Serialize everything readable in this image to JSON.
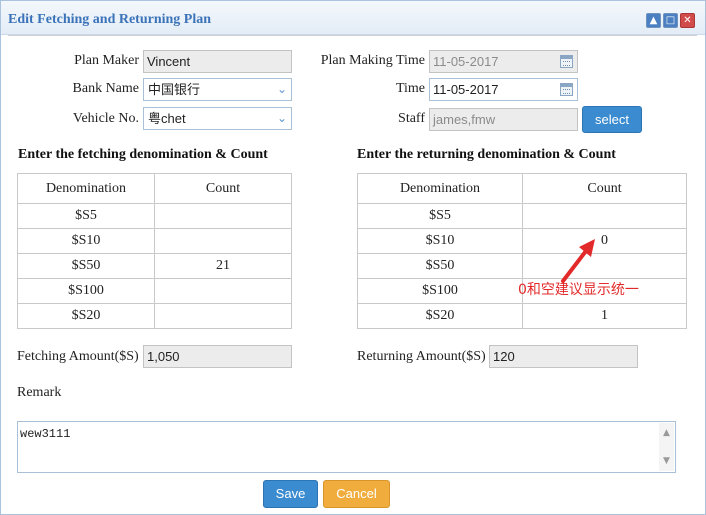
{
  "window": {
    "title": "Edit Fetching and Returning Plan",
    "minimize_glyph": "▲",
    "maximize_glyph": "□",
    "close_glyph": "✕"
  },
  "form": {
    "plan_maker": {
      "label": "Plan Maker",
      "value": "Vincent"
    },
    "plan_making_time": {
      "label": "Plan Making Time",
      "value": "11-05-2017"
    },
    "bank_name": {
      "label": "Bank Name",
      "value": "中国银行"
    },
    "time": {
      "label": "Time",
      "value": "11-05-2017"
    },
    "vehicle_no": {
      "label": "Vehicle No.",
      "value": "粤chet"
    },
    "staff": {
      "label": "Staff",
      "value": "james,fmw",
      "button_label": "select"
    }
  },
  "fetching": {
    "section_title": "Enter the fetching denomination & Count",
    "headers": [
      "Denomination",
      "Count"
    ],
    "rows": [
      {
        "denomination": "$S5",
        "count": ""
      },
      {
        "denomination": "$S10",
        "count": ""
      },
      {
        "denomination": "$S50",
        "count": "21"
      },
      {
        "denomination": "$S100",
        "count": ""
      },
      {
        "denomination": "$S20",
        "count": ""
      }
    ],
    "amount_label": "Fetching Amount($S)",
    "amount_value": "1,050"
  },
  "returning": {
    "section_title": "Enter the returning denomination & Count",
    "headers": [
      "Denomination",
      "Count"
    ],
    "rows": [
      {
        "denomination": "$S5",
        "count": ""
      },
      {
        "denomination": "$S10",
        "count": "0"
      },
      {
        "denomination": "$S50",
        "count": ""
      },
      {
        "denomination": "$S100",
        "count": ""
      },
      {
        "denomination": "$S20",
        "count": "1"
      }
    ],
    "amount_label": "Returning Amount($S)",
    "amount_value": "120"
  },
  "remark": {
    "label": "Remark",
    "value": "wew3111"
  },
  "actions": {
    "save_label": "Save",
    "cancel_label": "Cancel"
  },
  "annotation": {
    "text": "0和空建议显示统一",
    "color": "#e22a2a"
  },
  "colors": {
    "title": "#3b73b9",
    "primary": "#3a8bd0",
    "warning": "#f0ad3d",
    "close": "#d24b4b"
  }
}
